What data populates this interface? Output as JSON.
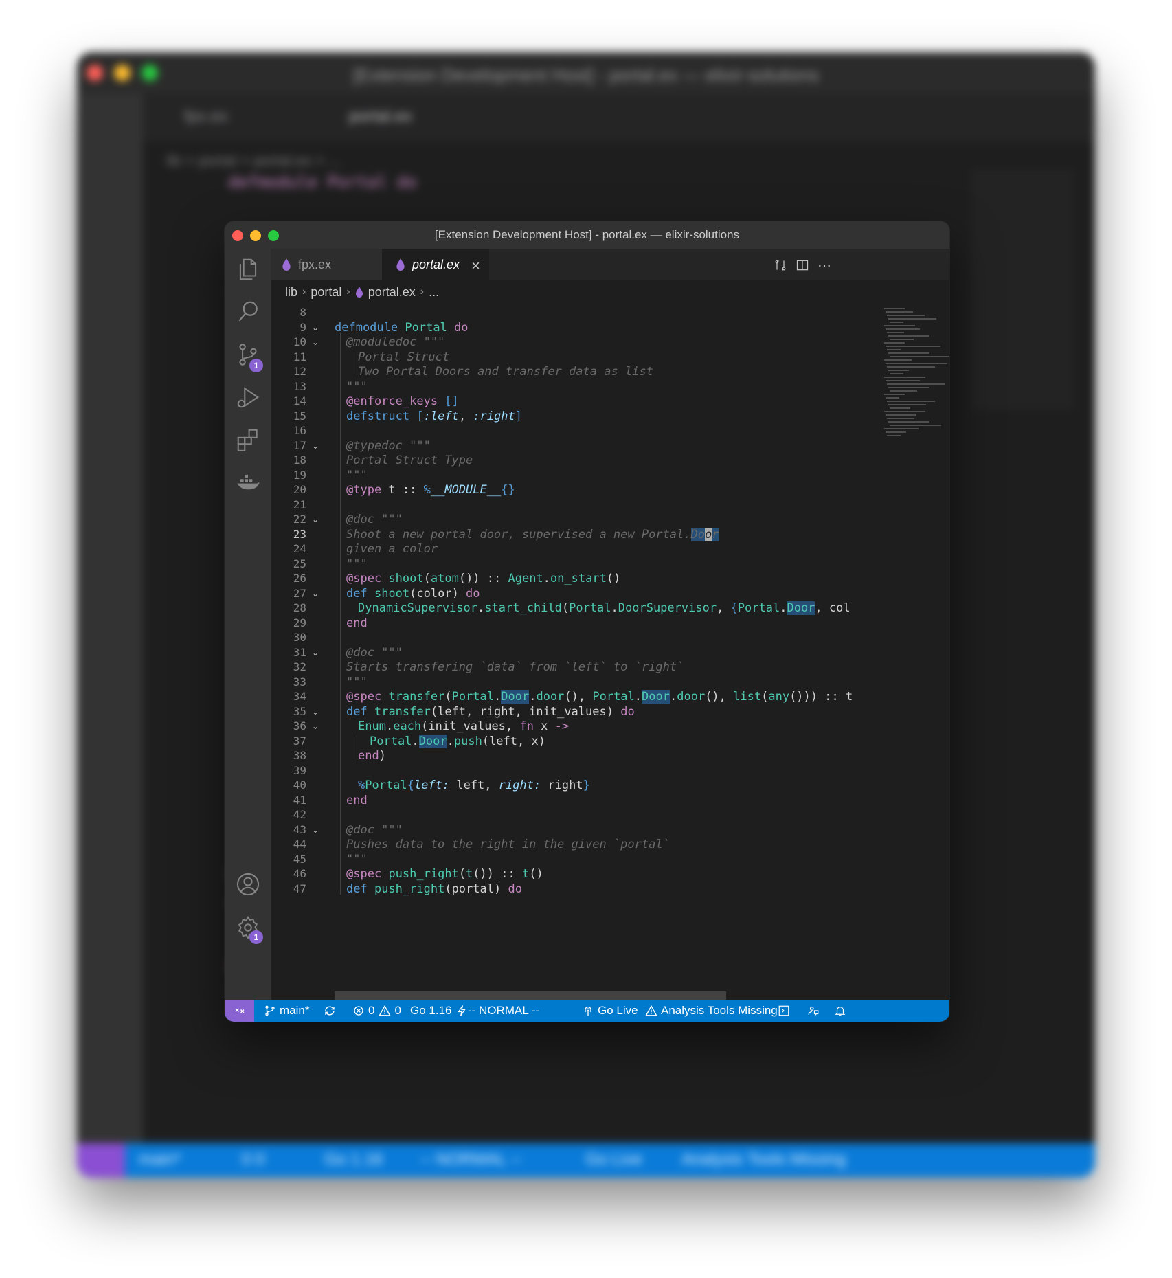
{
  "window": {
    "title": "[Extension Development Host] - portal.ex — elixir-solutions"
  },
  "tabs": [
    {
      "label": "fpx.ex",
      "active": false
    },
    {
      "label": "portal.ex",
      "active": true
    }
  ],
  "breadcrumb": [
    "lib",
    "portal",
    "portal.ex",
    "..."
  ],
  "activity_bar": {
    "icons": [
      "files-icon",
      "search-icon",
      "source-control-icon",
      "run-debug-icon",
      "extensions-icon",
      "docker-icon",
      "account-icon",
      "settings-gear-icon"
    ],
    "source_control_badge": "1",
    "settings_badge": "1"
  },
  "editor": {
    "line_numbers": [
      "8",
      "9",
      "10",
      "11",
      "12",
      "13",
      "14",
      "15",
      "16",
      "17",
      "18",
      "19",
      "20",
      "21",
      "22",
      "23",
      "24",
      "25",
      "26",
      "27",
      "28",
      "29",
      "30",
      "31",
      "32",
      "33",
      "34",
      "35",
      "36",
      "37",
      "38",
      "39",
      "40",
      "41",
      "42",
      "43",
      "44",
      "45",
      "46",
      "47"
    ],
    "active_line": "23"
  },
  "statusbar": {
    "branch": "main*",
    "errors": "0",
    "warnings": "0",
    "go_version": "Go 1.16",
    "vim_mode": "-- NORMAL --",
    "go_live": "Go Live",
    "analysis": "Analysis Tools Missing"
  },
  "background_window": {
    "title": "[Extension Development Host] - portal.ex — elixir-solutions",
    "tabs": [
      "fpx.ex",
      "portal.ex"
    ],
    "breadcrumb": "lib > portal > portal.ex > ...",
    "status": {
      "branch": "main*",
      "counts": "0 0",
      "go_version": "Go 1.16",
      "vim_mode": "-- NORMAL --",
      "go_live": "Go Live",
      "analysis": "Analysis Tools Missing"
    }
  },
  "colors": {
    "statusbar": "#007acc",
    "remote": "#8a63d2",
    "editor_bg": "#1e1e1e",
    "badge": "#8a63d2"
  }
}
